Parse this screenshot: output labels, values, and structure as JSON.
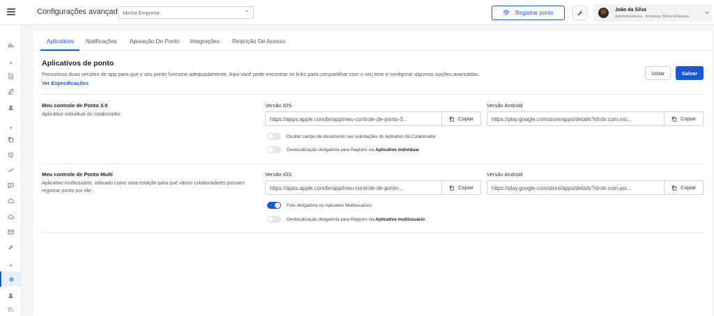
{
  "header": {
    "title": "Configurações avançadas",
    "company_select": "Minha Empresa",
    "register_button": "Registrar ponto",
    "user_name": "João da Silva",
    "user_role": "Administradores - Empresa: Minha Empresa"
  },
  "tabs": [
    {
      "label": "Aplicativos",
      "active": true
    },
    {
      "label": "Notificações",
      "active": false
    },
    {
      "label": "Apuração De Ponto",
      "active": false
    },
    {
      "label": "Integrações",
      "active": false
    },
    {
      "label": "Restrição De Acesso",
      "active": false
    }
  ],
  "section": {
    "title": "Aplicativos de ponto",
    "description": "Possuímos duas versões de app para que o seu ponto funcione adequadamente. Aqui você pode encontrar os links para compartilhar com o seu time e configurar algumas opções avançadas.",
    "link": "Ver Especificações",
    "back_button": "Voltar",
    "save_button": "Salvar"
  },
  "apps": [
    {
      "name": "Meu controle de Ponto 3.0",
      "description": "Aplicativo individual do colaborador.",
      "ios_label": "Versão iOS",
      "ios_url": "https://apps.apple.com/br/app/meu-controle-de-ponto-3...",
      "android_label": "Versão Android",
      "android_url": "https://play.google.com/store/apps/details?id=br.com.mo...",
      "copy_label": "Copiar",
      "toggles": [
        {
          "prefix": "Ocultar campo de documento nas solicitações do Aplicativo do Colaborador",
          "bold": "",
          "suffix": "",
          "on": false
        },
        {
          "prefix": "Geolocalização obrigatória para Registro via ",
          "bold": "Aplicativo individual",
          "suffix": ".",
          "on": false
        }
      ]
    },
    {
      "name": "Meu controle de Ponto Multi",
      "description": "Aplicativo multiusuário, utilizado como uma estação para que vários colaboradores possam registrar ponto por ele.",
      "ios_label": "Versão iOS",
      "ios_url": "https://apps.apple.com/br/app/meu-controle-de-ponto-...",
      "android_label": "Versão Android",
      "android_url": "https://play.google.com/store/apps/details?id=br.com.poi...",
      "copy_label": "Copiar",
      "toggles": [
        {
          "prefix": "Foto obrigatória no Aplicativo Multiusuários",
          "bold": "",
          "suffix": "",
          "on": true
        },
        {
          "prefix": "Geolocalização obrigatória para Registro via ",
          "bold": "Aplicativo multiusuário",
          "suffix": ".",
          "on": false
        }
      ]
    }
  ],
  "colors": {
    "accent": "#1a58d8",
    "background": "#f4f5f7"
  },
  "sidebar_icons": [
    "chart-icon",
    "document-icon",
    "pen-icon",
    "user-icon",
    "copy-icon",
    "alarm-icon",
    "trend-icon",
    "chat-icon",
    "cloud-icon",
    "cloud-sync-icon",
    "mail-icon",
    "wrench-icon",
    "gear-icon",
    "person-icon",
    "list-icon"
  ]
}
